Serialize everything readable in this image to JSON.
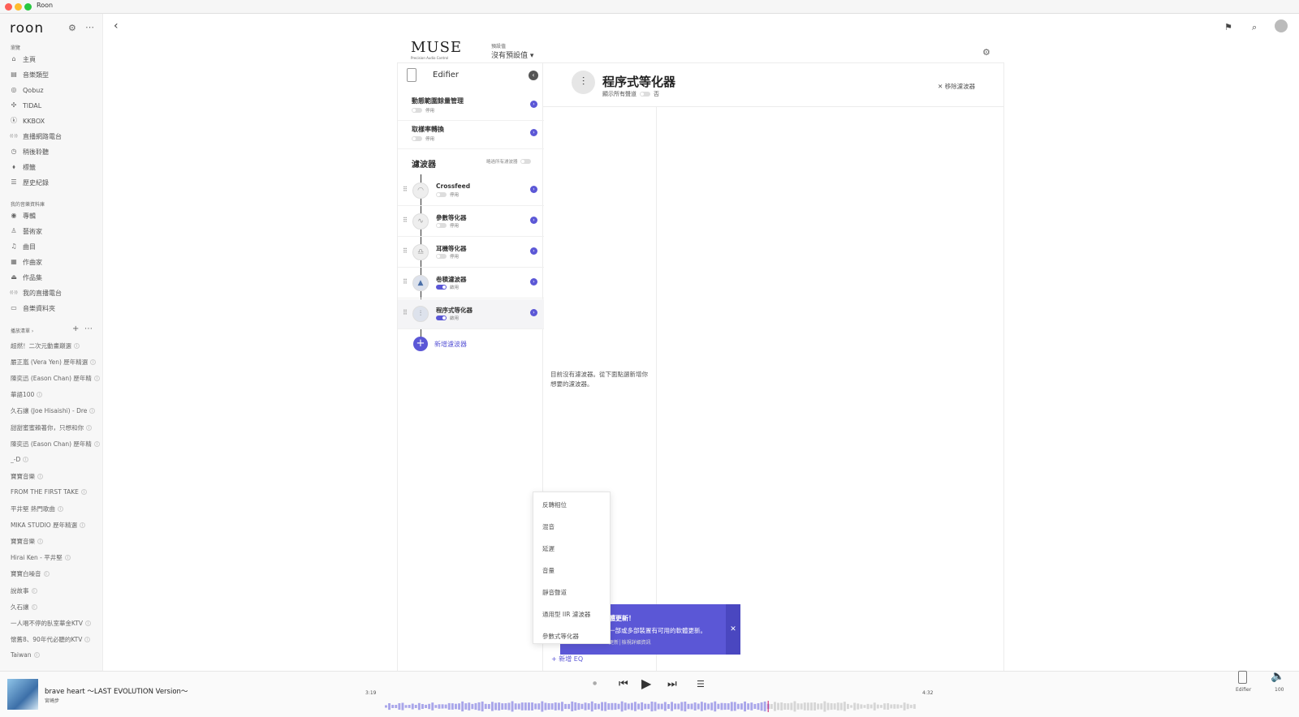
{
  "window": {
    "title": "Roon"
  },
  "sidebar": {
    "logo": "roon",
    "browse_label": "瀏覽",
    "browse": [
      {
        "icon": "home-icon",
        "label": "主頁",
        "g": "⌂"
      },
      {
        "icon": "genre-icon",
        "label": "音樂類型",
        "g": "▤"
      },
      {
        "icon": "qobuz-icon",
        "label": "Qobuz",
        "g": "◎"
      },
      {
        "icon": "tidal-icon",
        "label": "TIDAL",
        "g": "✣"
      },
      {
        "icon": "kkbox-icon",
        "label": "KKBOX",
        "g": "ⓚ"
      },
      {
        "icon": "radio-icon",
        "label": "直播網路電台",
        "g": "((·))"
      },
      {
        "icon": "listen-later-icon",
        "label": "稍後聆聽",
        "g": "◷"
      },
      {
        "icon": "tag-icon",
        "label": "標籤",
        "g": "⬧"
      },
      {
        "icon": "history-icon",
        "label": "歷史紀錄",
        "g": "☰"
      }
    ],
    "library_label": "我的音樂資料庫",
    "library": [
      {
        "icon": "album-icon",
        "label": "專輯",
        "g": "◉"
      },
      {
        "icon": "artist-icon",
        "label": "藝術家",
        "g": "♙"
      },
      {
        "icon": "track-icon",
        "label": "曲目",
        "g": "♫"
      },
      {
        "icon": "composer-icon",
        "label": "作曲家",
        "g": "▦"
      },
      {
        "icon": "composition-icon",
        "label": "作品集",
        "g": "⏏"
      },
      {
        "icon": "my-radio-icon",
        "label": "我的直播電台",
        "g": "((·))"
      },
      {
        "icon": "folder-icon",
        "label": "音樂資料夾",
        "g": "▭"
      }
    ],
    "playlists_label": "播放清單 ›",
    "playlists": [
      "超燃！二次元動畫巔選",
      "嚴正嵐 (Vera Yen) 歷年精選",
      "陳奕迅 (Eason Chan) 歷年精",
      "華語100",
      "久石讓 (Joe Hisaishi) - Dre",
      "甜甜蜜蜜賴著你，只想和你",
      "陳奕迅 (Eason Chan) 歷年精",
      "_-D",
      "寶寶音樂",
      "FROM THE FIRST TAKE",
      "平井堅 熱門歌曲",
      "MIKA STUDIO 歷年精選",
      "寶寶音樂",
      "Hirai Ken - 平井堅",
      "寶寶白噪音",
      "說故事",
      "久石讓",
      "一人唱不停的臥室華金KTV",
      "懷舊8、90年代必聽的KTV",
      "Taiwan"
    ]
  },
  "header": {
    "brand": "MUSE",
    "brand_sub": "Precision Audio Control",
    "preset_label": "預設值",
    "preset_value": "沒有預設值"
  },
  "device": {
    "name": "Edifier"
  },
  "dsp_rows": [
    {
      "title": "動態範圍餘量管理",
      "state": "停用"
    },
    {
      "title": "取樣率轉換",
      "state": "停用"
    }
  ],
  "filters_section": {
    "title": "濾波器",
    "toggle_label": "略過所有濾波器"
  },
  "filters": [
    {
      "name": "Crossfeed",
      "state": "停用",
      "on": false,
      "icon": "crossfeed-icon",
      "g": "◠"
    },
    {
      "name": "參數等化器",
      "state": "停用",
      "on": false,
      "icon": "parametric-eq-icon",
      "g": "∿"
    },
    {
      "name": "耳機等化器",
      "state": "停用",
      "on": false,
      "icon": "headphone-eq-icon",
      "g": "♎"
    },
    {
      "name": "卷積濾波器",
      "state": "啟用",
      "on": true,
      "icon": "convolution-icon",
      "g": "▲"
    },
    {
      "name": "程序式等化器",
      "state": "啟用",
      "on": true,
      "icon": "procedural-eq-icon",
      "g": "⫶"
    }
  ],
  "add_filter": "新增濾波器",
  "detail": {
    "title": "程序式等化器",
    "show_channels": "顯示所有聲道",
    "show_channels_value": "否",
    "remove": "移除濾波器",
    "empty_text": "目前沒有濾波器。從下面點選新增你想要的濾波器。",
    "add_eq": "新增 EQ"
  },
  "menu": [
    "反轉相位",
    "混音",
    "延遲",
    "音量",
    "靜音聲道",
    "通用型 IIR 濾波器",
    "參數式等化器"
  ],
  "toast": {
    "title": "體更新！",
    "body": "一部或多部裝置有可用的軟體更新。",
    "link": "更新│檢視詳細資訊"
  },
  "now_playing": {
    "title": "brave heart 〜LAST EVOLUTION Version〜",
    "artist": "宮崎步",
    "elapsed": "3:19",
    "total": "4:32",
    "progress": 0.72,
    "zone": "Edifier",
    "volume": "100"
  },
  "colors": {
    "accent": "#5b57d6"
  }
}
